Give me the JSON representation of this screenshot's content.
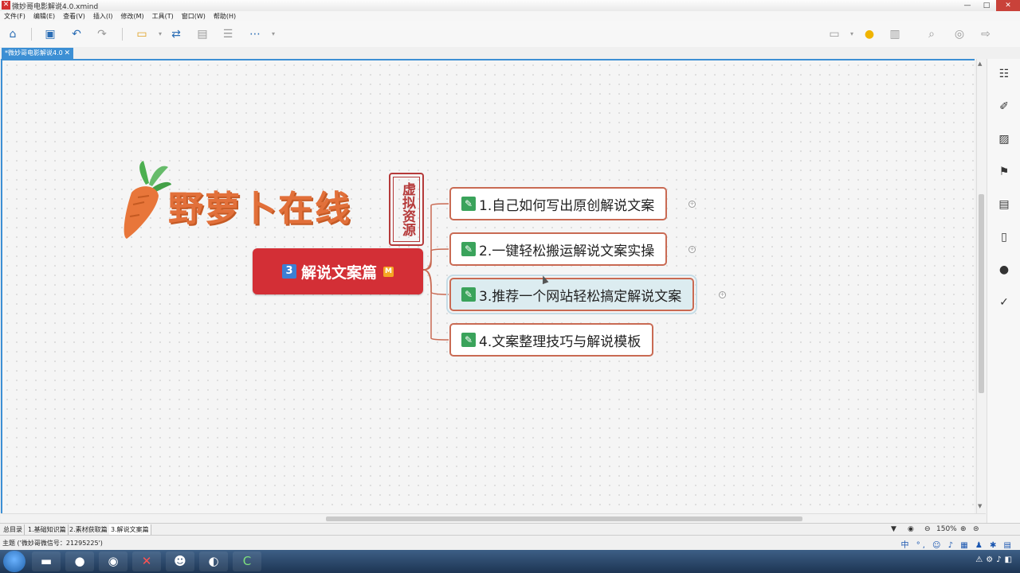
{
  "window": {
    "title": "微妙哥电影解说4.0.xmind",
    "controls": [
      "—",
      "□",
      "✕"
    ]
  },
  "menu": [
    "文件(F)",
    "编辑(E)",
    "查看(V)",
    "插入(I)",
    "修改(M)",
    "工具(T)",
    "窗口(W)",
    "帮助(H)"
  ],
  "tab": {
    "label": "*微妙哥电影解说4.0",
    "close": "✕"
  },
  "mindmap": {
    "logo_text": "野萝卜在线",
    "stamp_text": "虚拟资源",
    "root": {
      "number": "3",
      "label": "解说文案篇",
      "marker": "M"
    },
    "children": [
      {
        "label": "1.自己如何写出原创解说文案"
      },
      {
        "label": "2.一键轻松搬运解说文案实操"
      },
      {
        "label": "3.推荐一个网站轻松搞定解说文案"
      },
      {
        "label": "4.文案整理技巧与解说模板"
      }
    ]
  },
  "sheets": [
    "总目录",
    "1.基础知识篇",
    "2.素材获取篇",
    "3.解说文案篇"
  ],
  "zoom": "150%",
  "status_text": "主题 ('微妙哥微信号：21295225')",
  "ime": "中 °, ☺ ♪ ▦ ♟ ✱ ▤",
  "colors": {
    "root": "#d32f36",
    "node_border": "#c96a53",
    "accent": "#3c8fd4"
  }
}
